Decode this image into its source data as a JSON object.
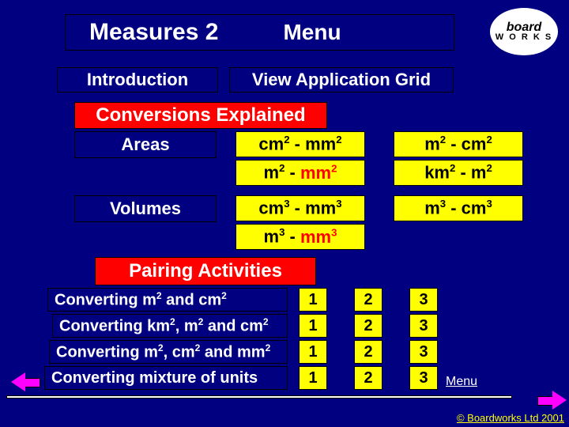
{
  "header": {
    "title": "Measures 2",
    "menu": "Menu"
  },
  "logo": {
    "brand": "board",
    "sub": "W O R K S"
  },
  "nav": {
    "introduction": "Introduction",
    "view_grid": "View Application Grid",
    "conversions_heading": "Conversions Explained",
    "areas": "Areas",
    "volumes": "Volumes",
    "pairing_heading": "Pairing Activities",
    "menu_small": "Menu"
  },
  "conv": {
    "cm2_mm2": "cm2 - mm2",
    "m2_cm2": "m2 - cm2",
    "m2_mm2_a": "m2 - ",
    "m2_mm2_b": "mm2",
    "km2_m2": "km2 - m2",
    "cm3_mm3": "cm3 - mm3",
    "m3_cm3": "m3 - cm3",
    "m3_mm3_a": "m3 - ",
    "m3_mm3_b": "mm3"
  },
  "pairs": {
    "r1": "Converting m2 and cm2",
    "r2": "Converting km2, m2 and cm2",
    "r3": "Converting m2, cm2 and mm2",
    "r4": "Converting mixture of units",
    "n1": "1",
    "n2": "2",
    "n3": "3"
  },
  "footer": {
    "copyright": "© Boardworks Ltd 2001"
  }
}
